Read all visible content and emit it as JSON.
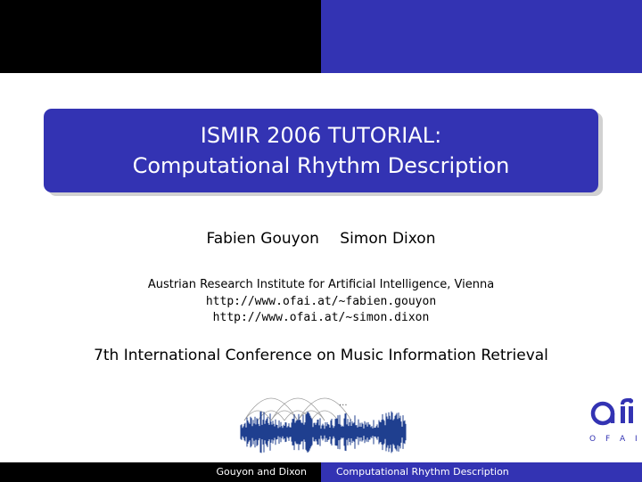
{
  "title": {
    "line1": "ISMIR 2006 TUTORIAL:",
    "line2": "Computational Rhythm Description"
  },
  "authors": [
    "Fabien Gouyon",
    "Simon Dixon"
  ],
  "affiliation": "Austrian Research Institute for Artificial Intelligence, Vienna",
  "urls": [
    "http://www.ofai.at/~fabien.gouyon",
    "http://www.ofai.at/~simon.dixon"
  ],
  "conference": "7th International Conference on Music Information Retrieval",
  "figure": {
    "ellipsis": "..."
  },
  "logo": {
    "text": "O F A I",
    "icon": "ofai-logo"
  },
  "footer": {
    "authors": "Gouyon and Dixon",
    "title": "Computational Rhythm Description"
  },
  "colors": {
    "accent": "#3333b3",
    "bar_dark": "#000000",
    "wave": "#1f3f8f"
  }
}
